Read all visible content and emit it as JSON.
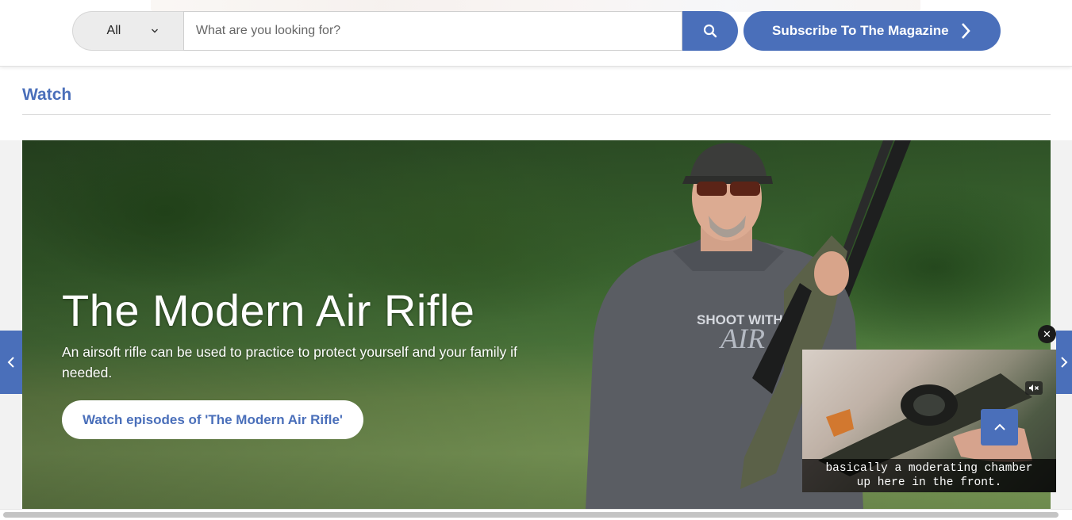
{
  "header": {
    "search": {
      "category_label": "All",
      "placeholder": "What are you looking for?",
      "value": ""
    },
    "subscribe_label": "Subscribe To The Magazine"
  },
  "section": {
    "heading": "Watch"
  },
  "hero": {
    "title": "The Modern Air Rifle",
    "description": "An airsoft rifle can be used to practice to protect yourself and your family if needed.",
    "cta_label": "Watch episodes of 'The Modern Air Rifle'"
  },
  "video": {
    "close_label": "✕",
    "caption_line1": "basically a moderating chamber",
    "caption_line2": "up here in the front."
  },
  "colors": {
    "brand_blue": "#4a6fba",
    "white": "#ffffff"
  },
  "icons": {
    "search": "search-icon",
    "chevron": "chevron-right-icon",
    "mute": "muted-speaker-icon",
    "back_to_top": "chevron-up-icon"
  }
}
